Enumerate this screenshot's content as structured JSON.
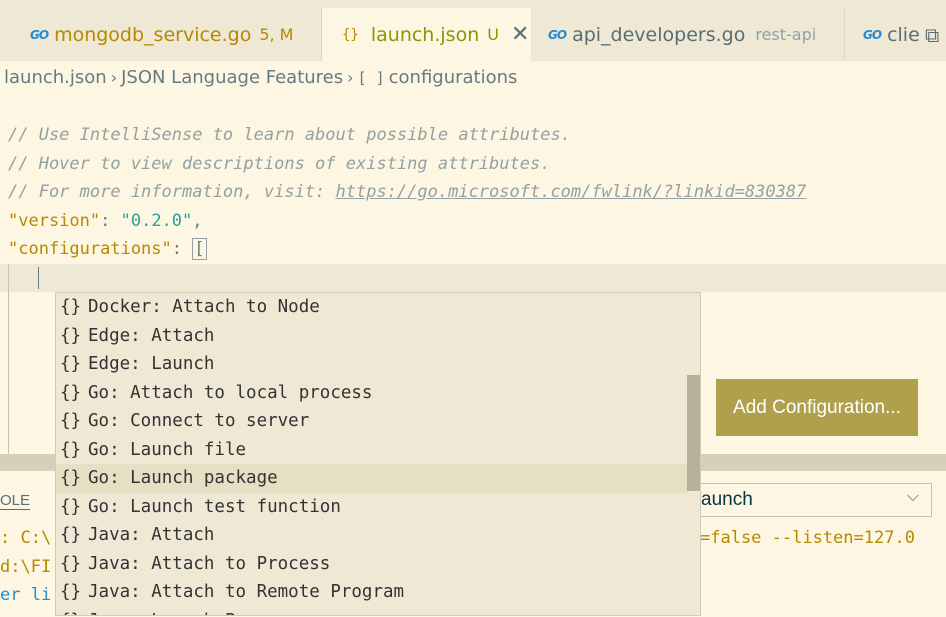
{
  "tabs": [
    {
      "icon": "go",
      "name": "mongodb_service.go",
      "badge": "5, M",
      "desc": ""
    },
    {
      "icon": "braces",
      "name": "launch.json",
      "badge": "U",
      "desc": ""
    },
    {
      "icon": "go",
      "name": "api_developers.go",
      "badge": "",
      "desc": "rest-api"
    },
    {
      "icon": "go",
      "name": "clie",
      "badge": "",
      "desc": ""
    }
  ],
  "breadcrumb": {
    "file": "launch.json",
    "section": "JSON Language Features",
    "symbol_icon": "[ ]",
    "symbol": "configurations"
  },
  "code": {
    "comment1": "// Use IntelliSense to learn about possible attributes.",
    "comment2": "// Hover to view descriptions of existing attributes.",
    "comment3_prefix": "// For more information, visit: ",
    "comment3_link": "https://go.microsoft.com/fwlink/?linkid=830387",
    "version_key": "\"version\"",
    "version_value": "\"0.2.0\"",
    "config_key": "\"configurations\"",
    "bracket": "["
  },
  "add_configuration_label": "Add Configuration...",
  "panel": {
    "tab_label": "OLE",
    "launch_select": "aunch",
    "term_line1_left": ": C:\\",
    "term_line1_right": "=false --listen=127.0",
    "term_line2_left": "d:\\FI",
    "term_line3_left": "er li"
  },
  "suggestions": {
    "icon": "{}",
    "items": [
      "Docker: Attach to Node",
      "Edge: Attach",
      "Edge: Launch",
      "Go: Attach to local process",
      "Go: Connect to server",
      "Go: Launch file",
      "Go: Launch package",
      "Go: Launch test function",
      "Java: Attach",
      "Java: Attach to Process",
      "Java: Attach to Remote Program",
      "Java: Launch Program"
    ],
    "selected_index": 6
  },
  "icons": {
    "go": "GO",
    "close": "✕",
    "split": "⧉",
    "chevron": "›",
    "chevron_down": "⌵"
  },
  "colors": {
    "background": "#fdf6e3",
    "accent_button": "#b0a04c",
    "modified": "#b58900",
    "untracked": "#859900"
  }
}
